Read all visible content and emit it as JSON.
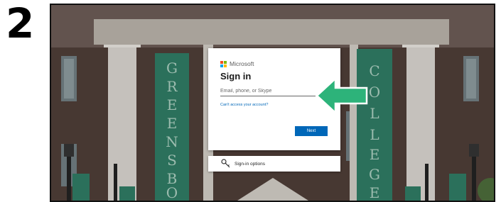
{
  "step": {
    "number": "2"
  },
  "signin": {
    "brand": "Microsoft",
    "title": "Sign in",
    "email_placeholder": "Email, phone, or Skype",
    "cant_access": "Can't access your account?",
    "next_label": "Next"
  },
  "signin_options": {
    "label": "Sign-in options"
  },
  "background": {
    "left_banner": "GREENSBORO",
    "right_banner": "COLLEGE"
  },
  "colors": {
    "accent_blue": "#0067b8",
    "arrow_green": "#2db37a",
    "banner_green": "#2f7a63",
    "ms_red": "#f25022",
    "ms_green": "#7fba00",
    "ms_blue": "#00a4ef",
    "ms_yellow": "#ffb900"
  }
}
